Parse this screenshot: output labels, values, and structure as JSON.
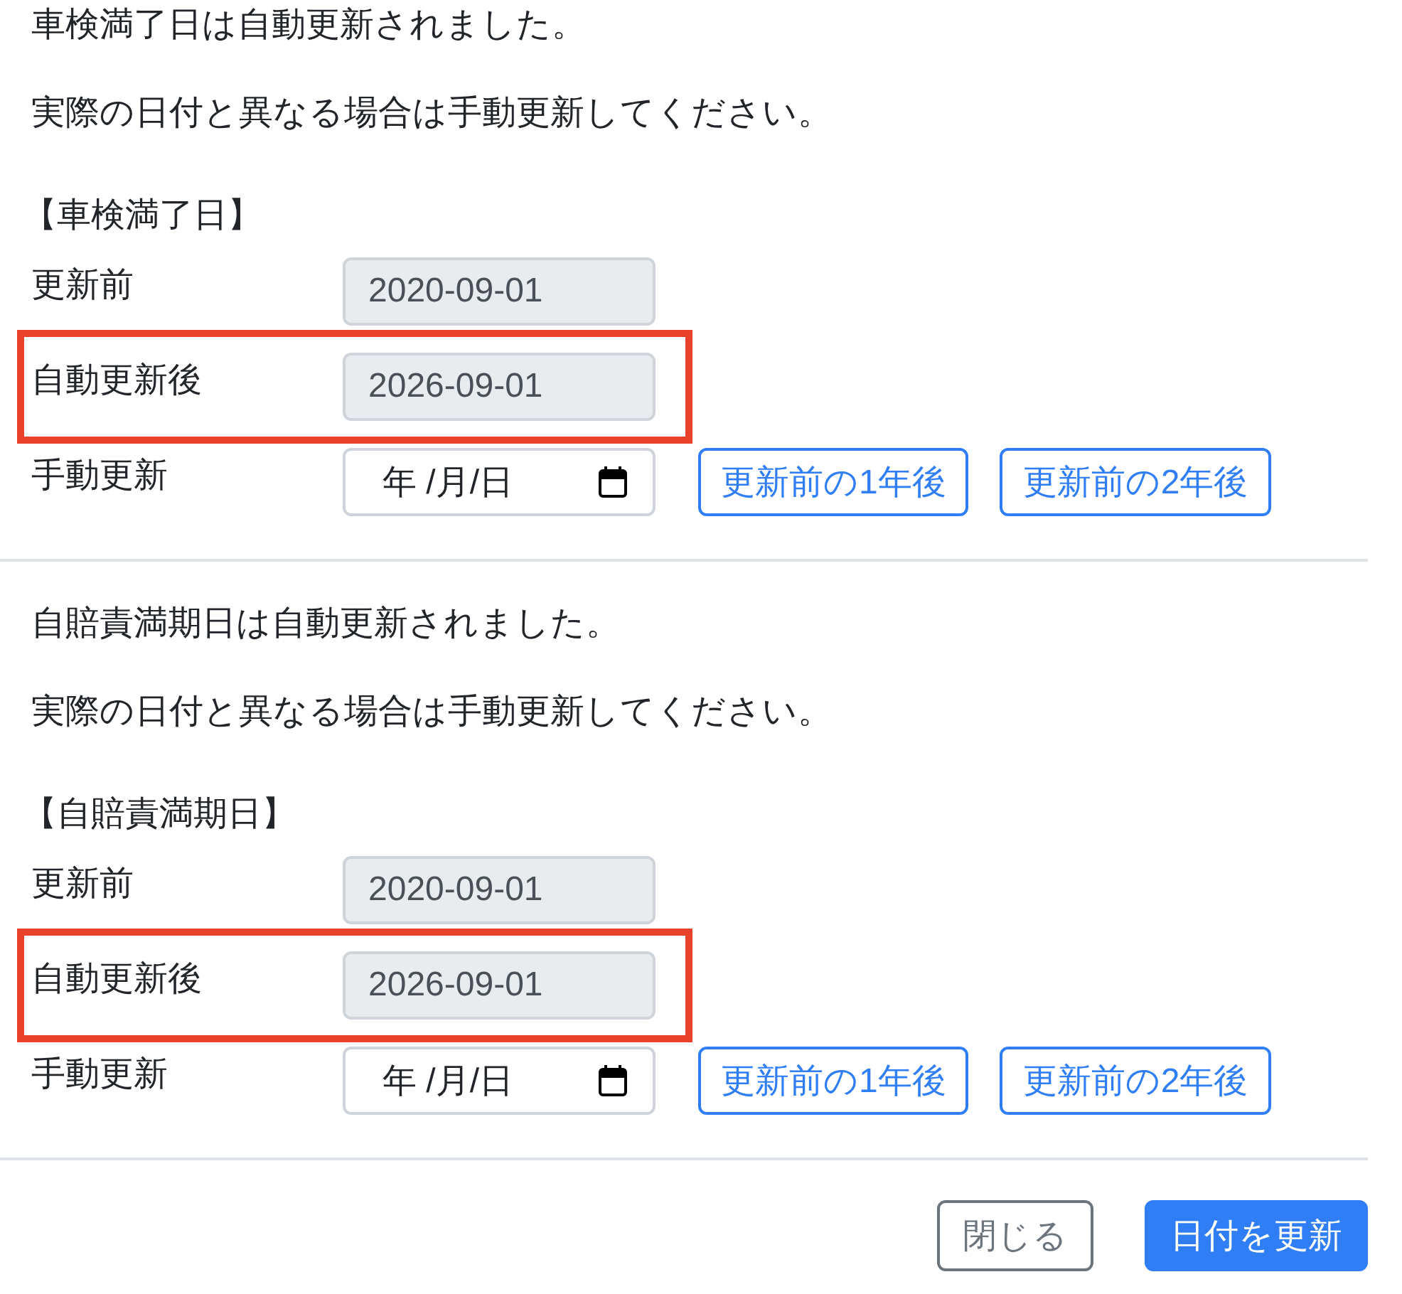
{
  "sections": [
    {
      "message_lines": [
        "車検満了日は自動更新されました。",
        "実際の日付と異なる場合は手動更新してください。"
      ],
      "heading": "【車検満了日】",
      "rows": [
        {
          "kind": "readonly",
          "label": "更新前",
          "value": "2020-09-01",
          "highlighted": false
        },
        {
          "kind": "readonly",
          "label": "自動更新後",
          "value": "2026-09-01",
          "highlighted": true
        },
        {
          "kind": "date",
          "label": "手動更新",
          "placeholder": "年 /月/日",
          "highlighted": false,
          "buttons": [
            "更新前の1年後",
            "更新前の2年後"
          ]
        }
      ]
    },
    {
      "message_lines": [
        "自賠責満期日は自動更新されました。",
        "実際の日付と異なる場合は手動更新してください。"
      ],
      "heading": "【自賠責満期日】",
      "rows": [
        {
          "kind": "readonly",
          "label": "更新前",
          "value": "2020-09-01",
          "highlighted": false
        },
        {
          "kind": "readonly",
          "label": "自動更新後",
          "value": "2026-09-01",
          "highlighted": true
        },
        {
          "kind": "date",
          "label": "手動更新",
          "placeholder": "年 /月/日",
          "highlighted": false,
          "buttons": [
            "更新前の1年後",
            "更新前の2年後"
          ]
        }
      ]
    }
  ],
  "footer": {
    "buttons": [
      {
        "label": "閉じる",
        "kind": "secondary"
      },
      {
        "label": "日付を更新",
        "kind": "primary"
      }
    ]
  }
}
